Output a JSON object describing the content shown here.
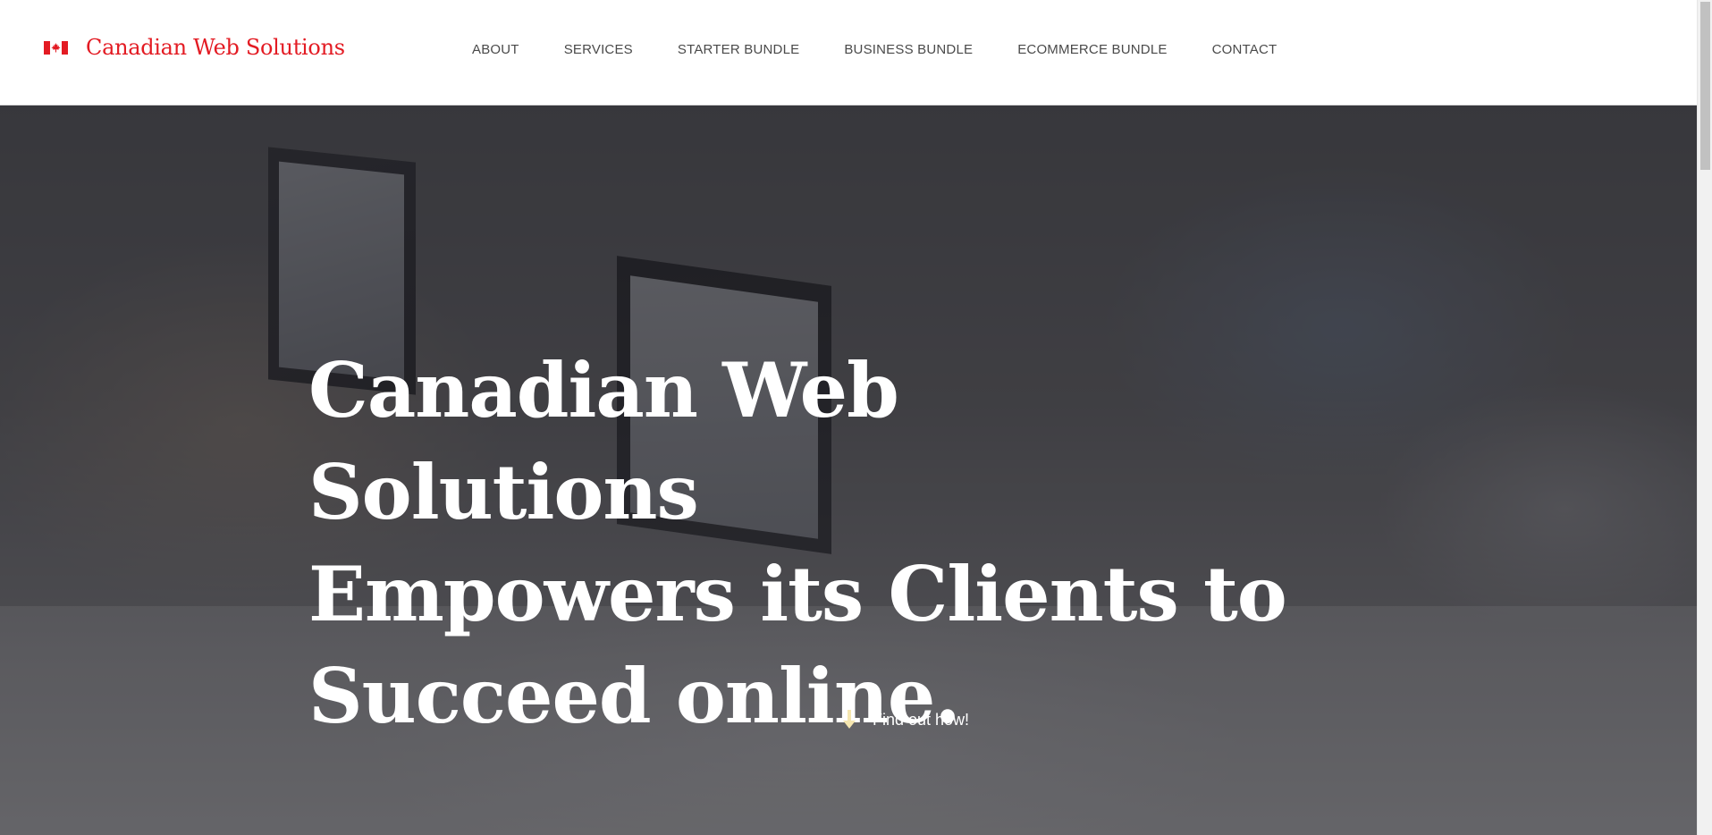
{
  "header": {
    "brand_name": "Canadian Web Solutions",
    "flag_icon": "canada-flag-icon",
    "nav": [
      {
        "label": "ABOUT"
      },
      {
        "label": "SERVICES"
      },
      {
        "label": "STARTER BUNDLE"
      },
      {
        "label": "BUSINESS BUNDLE"
      },
      {
        "label": "ECOMMERCE BUNDLE"
      },
      {
        "label": "CONTACT"
      }
    ]
  },
  "hero": {
    "headline_lines": [
      "Canadian Web Solutions",
      "Empowers its Clients to",
      "Succeed online."
    ],
    "cta_label": "Find out how!",
    "cta_icon": "arrow-down-icon"
  },
  "colors": {
    "brand": "#e31b23",
    "nav_text": "#4a4a4a",
    "hero_text": "#ffffff",
    "cta_arrow": "#f5e6b0"
  }
}
